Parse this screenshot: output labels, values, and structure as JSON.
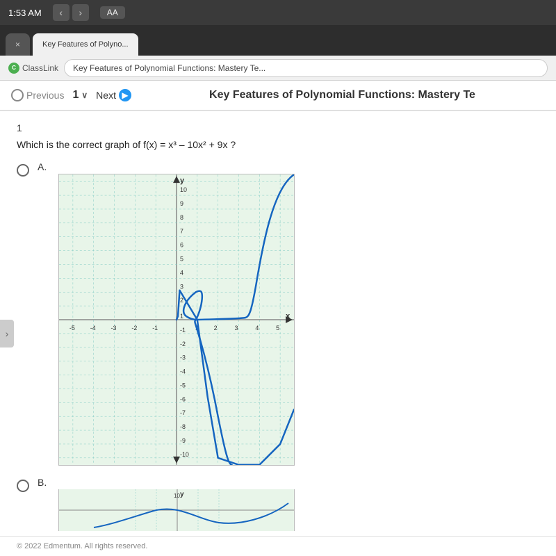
{
  "browser": {
    "time": "1:53 AM",
    "tab_inactive": "×",
    "tab_active_label": "Key Features of Polyno...",
    "address_classlink": "ClassLink",
    "address_url": "Key Features of Polynomial Functions: Mastery Te..."
  },
  "toolbar": {
    "previous_label": "Previous",
    "next_label": "Next",
    "question_number": "1",
    "dropdown_symbol": "∨",
    "page_title": "Key Features of Polynomial Functions: Mastery Te"
  },
  "question": {
    "number": "1",
    "text": "Which is the correct graph of f(x) = x³ – 10x² + 9x ?",
    "options": [
      {
        "label": "A.",
        "value": "A"
      },
      {
        "label": "B.",
        "value": "B"
      }
    ]
  },
  "graph_a": {
    "x_min": -5,
    "x_max": 5,
    "y_min": -10,
    "y_max": 10,
    "x_label": "x",
    "y_label": "y"
  },
  "footer": {
    "copyright": "© 2022 Edmentum. All rights reserved."
  }
}
